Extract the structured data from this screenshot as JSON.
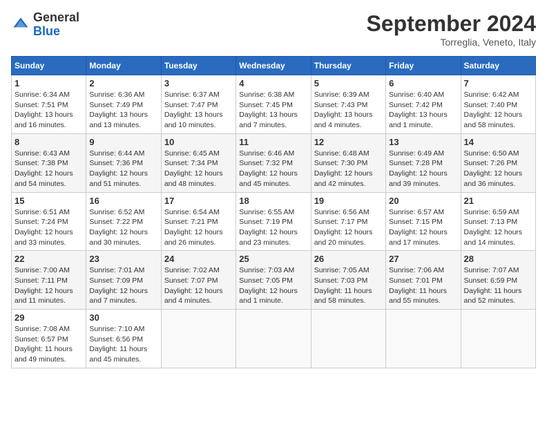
{
  "logo": {
    "general": "General",
    "blue": "Blue"
  },
  "title": "September 2024",
  "location": "Torreglia, Veneto, Italy",
  "days_of_week": [
    "Sunday",
    "Monday",
    "Tuesday",
    "Wednesday",
    "Thursday",
    "Friday",
    "Saturday"
  ],
  "weeks": [
    [
      {
        "num": "1",
        "sunrise": "6:34 AM",
        "sunset": "7:51 PM",
        "daylight": "13 hours and 16 minutes."
      },
      {
        "num": "2",
        "sunrise": "6:36 AM",
        "sunset": "7:49 PM",
        "daylight": "13 hours and 13 minutes."
      },
      {
        "num": "3",
        "sunrise": "6:37 AM",
        "sunset": "7:47 PM",
        "daylight": "13 hours and 10 minutes."
      },
      {
        "num": "4",
        "sunrise": "6:38 AM",
        "sunset": "7:45 PM",
        "daylight": "13 hours and 7 minutes."
      },
      {
        "num": "5",
        "sunrise": "6:39 AM",
        "sunset": "7:43 PM",
        "daylight": "13 hours and 4 minutes."
      },
      {
        "num": "6",
        "sunrise": "6:40 AM",
        "sunset": "7:42 PM",
        "daylight": "13 hours and 1 minute."
      },
      {
        "num": "7",
        "sunrise": "6:42 AM",
        "sunset": "7:40 PM",
        "daylight": "12 hours and 58 minutes."
      }
    ],
    [
      {
        "num": "8",
        "sunrise": "6:43 AM",
        "sunset": "7:38 PM",
        "daylight": "12 hours and 54 minutes."
      },
      {
        "num": "9",
        "sunrise": "6:44 AM",
        "sunset": "7:36 PM",
        "daylight": "12 hours and 51 minutes."
      },
      {
        "num": "10",
        "sunrise": "6:45 AM",
        "sunset": "7:34 PM",
        "daylight": "12 hours and 48 minutes."
      },
      {
        "num": "11",
        "sunrise": "6:46 AM",
        "sunset": "7:32 PM",
        "daylight": "12 hours and 45 minutes."
      },
      {
        "num": "12",
        "sunrise": "6:48 AM",
        "sunset": "7:30 PM",
        "daylight": "12 hours and 42 minutes."
      },
      {
        "num": "13",
        "sunrise": "6:49 AM",
        "sunset": "7:28 PM",
        "daylight": "12 hours and 39 minutes."
      },
      {
        "num": "14",
        "sunrise": "6:50 AM",
        "sunset": "7:26 PM",
        "daylight": "12 hours and 36 minutes."
      }
    ],
    [
      {
        "num": "15",
        "sunrise": "6:51 AM",
        "sunset": "7:24 PM",
        "daylight": "12 hours and 33 minutes."
      },
      {
        "num": "16",
        "sunrise": "6:52 AM",
        "sunset": "7:22 PM",
        "daylight": "12 hours and 30 minutes."
      },
      {
        "num": "17",
        "sunrise": "6:54 AM",
        "sunset": "7:21 PM",
        "daylight": "12 hours and 26 minutes."
      },
      {
        "num": "18",
        "sunrise": "6:55 AM",
        "sunset": "7:19 PM",
        "daylight": "12 hours and 23 minutes."
      },
      {
        "num": "19",
        "sunrise": "6:56 AM",
        "sunset": "7:17 PM",
        "daylight": "12 hours and 20 minutes."
      },
      {
        "num": "20",
        "sunrise": "6:57 AM",
        "sunset": "7:15 PM",
        "daylight": "12 hours and 17 minutes."
      },
      {
        "num": "21",
        "sunrise": "6:59 AM",
        "sunset": "7:13 PM",
        "daylight": "12 hours and 14 minutes."
      }
    ],
    [
      {
        "num": "22",
        "sunrise": "7:00 AM",
        "sunset": "7:11 PM",
        "daylight": "12 hours and 11 minutes."
      },
      {
        "num": "23",
        "sunrise": "7:01 AM",
        "sunset": "7:09 PM",
        "daylight": "12 hours and 7 minutes."
      },
      {
        "num": "24",
        "sunrise": "7:02 AM",
        "sunset": "7:07 PM",
        "daylight": "12 hours and 4 minutes."
      },
      {
        "num": "25",
        "sunrise": "7:03 AM",
        "sunset": "7:05 PM",
        "daylight": "12 hours and 1 minute."
      },
      {
        "num": "26",
        "sunrise": "7:05 AM",
        "sunset": "7:03 PM",
        "daylight": "11 hours and 58 minutes."
      },
      {
        "num": "27",
        "sunrise": "7:06 AM",
        "sunset": "7:01 PM",
        "daylight": "11 hours and 55 minutes."
      },
      {
        "num": "28",
        "sunrise": "7:07 AM",
        "sunset": "6:59 PM",
        "daylight": "11 hours and 52 minutes."
      }
    ],
    [
      {
        "num": "29",
        "sunrise": "7:08 AM",
        "sunset": "6:57 PM",
        "daylight": "11 hours and 49 minutes."
      },
      {
        "num": "30",
        "sunrise": "7:10 AM",
        "sunset": "6:56 PM",
        "daylight": "11 hours and 45 minutes."
      },
      null,
      null,
      null,
      null,
      null
    ]
  ]
}
